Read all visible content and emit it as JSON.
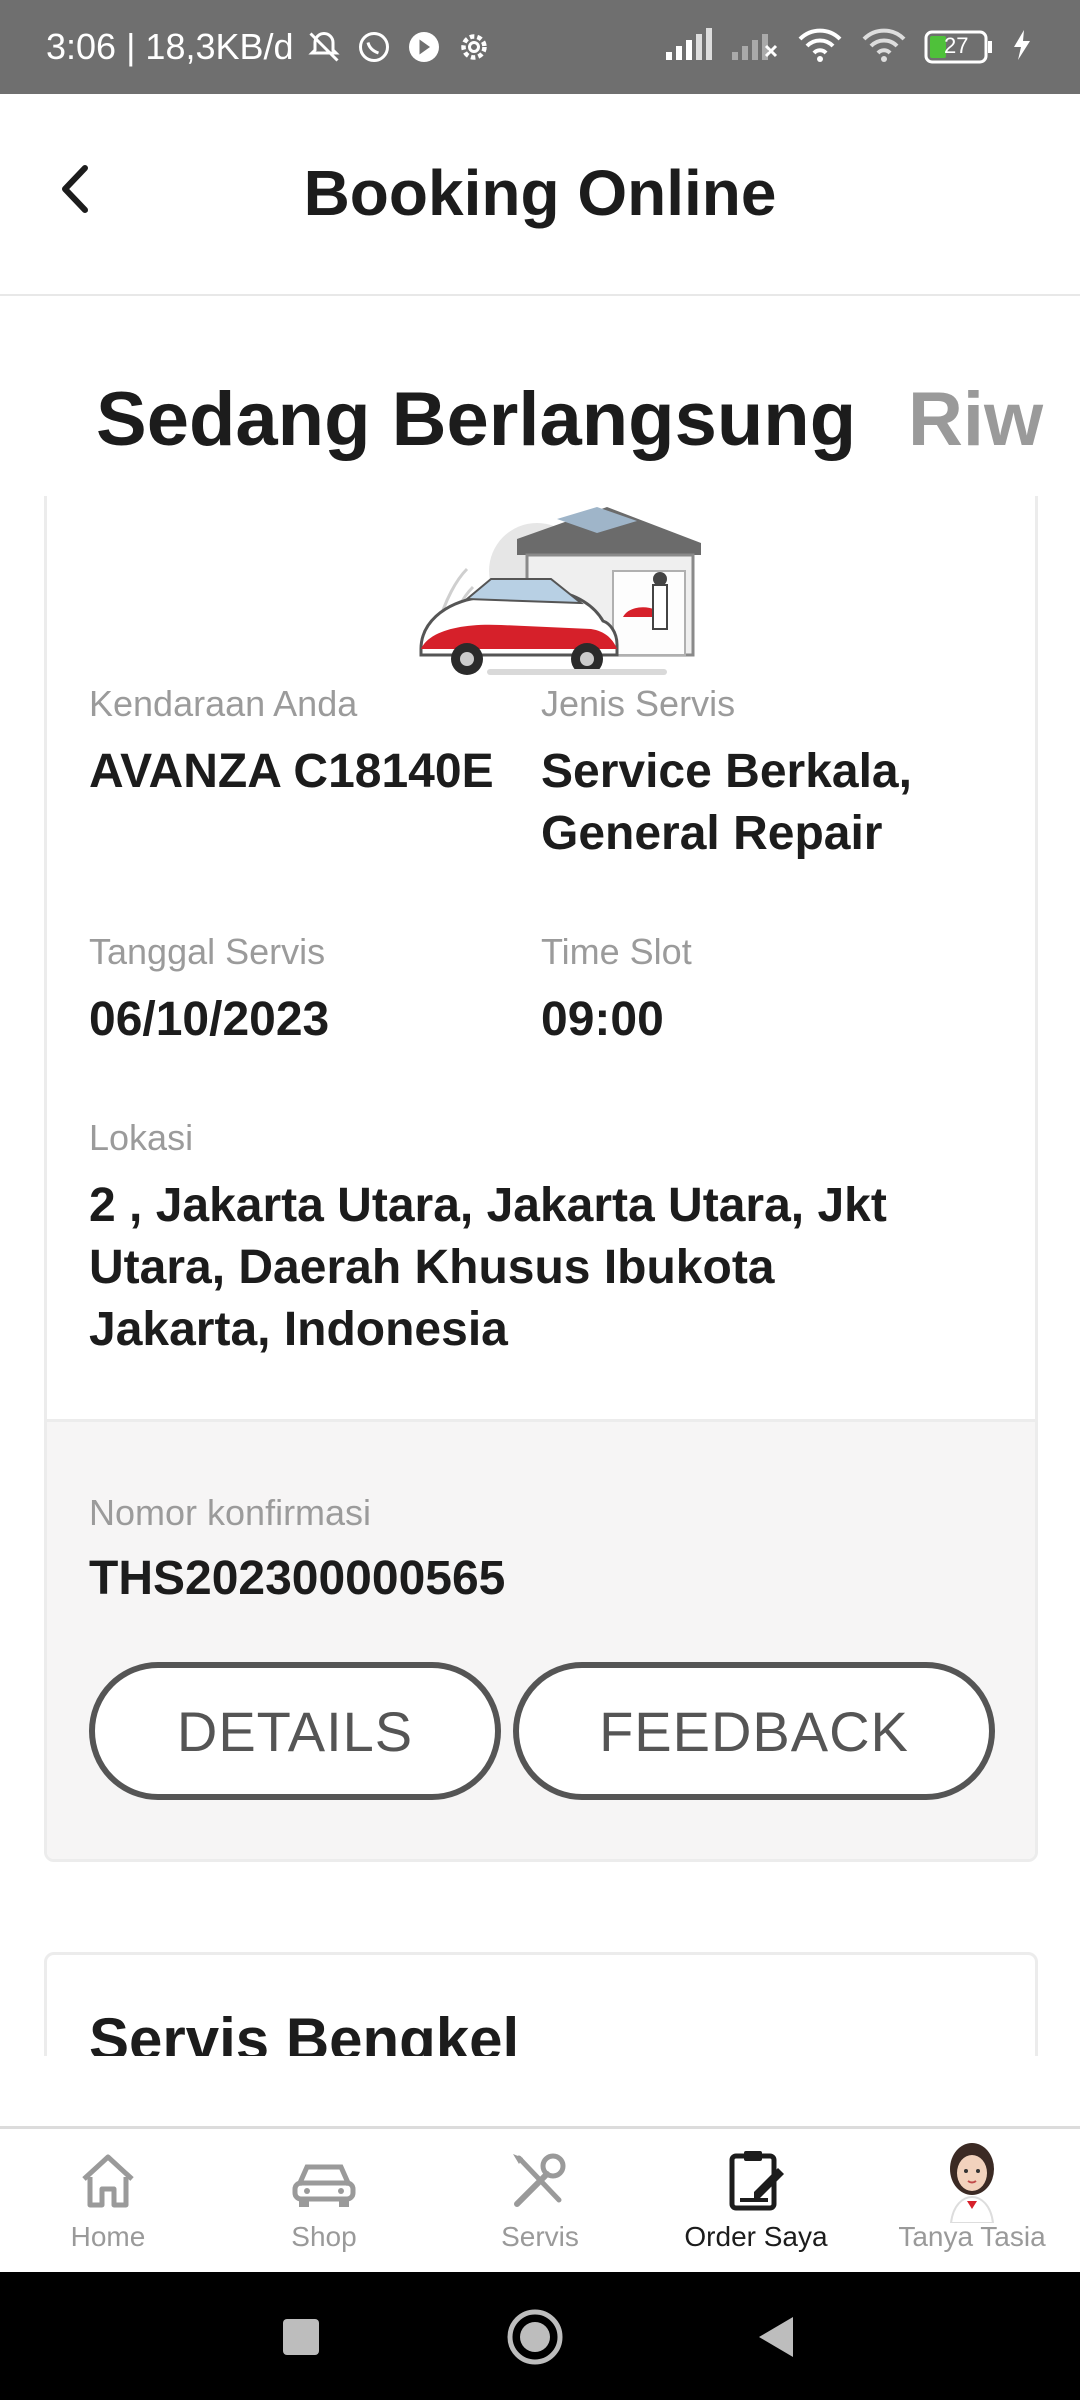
{
  "status_bar": {
    "time_speed": "3:06 | 18,3KB/d",
    "battery": "27"
  },
  "app_bar": {
    "title": "Booking Online"
  },
  "tabs": [
    {
      "label": "Sedang Berlangsung"
    },
    {
      "label": "Riw"
    }
  ],
  "booking": {
    "vehicle_label": "Kendaraan Anda",
    "vehicle_value": "AVANZA C18140E",
    "service_type_label": "Jenis Servis",
    "service_type_value": "Service Berkala, General Repair",
    "date_label": "Tanggal Servis",
    "date_value": "06/10/2023",
    "time_slot_label": "Time Slot",
    "time_slot_value": "09:00",
    "location_label": "Lokasi",
    "location_value": "2 , Jakarta Utara, Jakarta Utara, Jkt Utara, Daerah Khusus Ibukota Jakarta, Indonesia",
    "confirmation_label": "Nomor konfirmasi",
    "confirmation_value": "THS202300000565",
    "details_button": "DETAILS",
    "feedback_button": "FEEDBACK"
  },
  "next_card": {
    "title": "Servis Bengkel"
  },
  "bottom_nav": [
    {
      "label": "Home",
      "icon": "home-icon"
    },
    {
      "label": "Shop",
      "icon": "car-icon"
    },
    {
      "label": "Servis",
      "icon": "tools-icon"
    },
    {
      "label": "Order Saya",
      "icon": "clipboard-edit-icon",
      "active": true
    },
    {
      "label": "Tanya Tasia",
      "icon": "assistant-avatar"
    }
  ],
  "colors": {
    "status_bar_bg": "#6f6f6f",
    "accent_red": "#d6202a",
    "text_dark": "#1c1c1c",
    "text_muted": "#9b9b9b",
    "button_outline": "#555555"
  }
}
